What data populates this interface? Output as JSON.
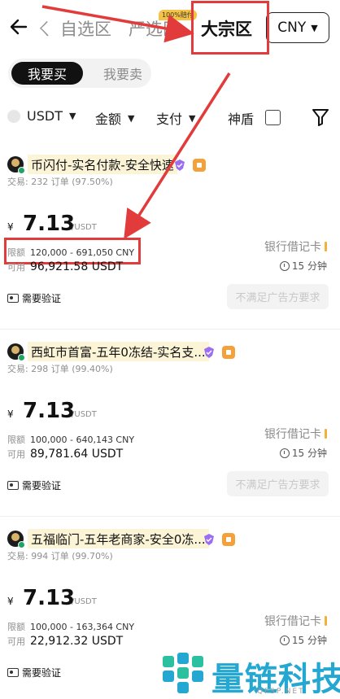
{
  "header": {
    "back_icon": "back-arrow-icon",
    "partial_tab": "ㄑ",
    "tabs": [
      {
        "label": "自选区",
        "active": false
      },
      {
        "label": "严选区",
        "active": false,
        "badge": "100%赔付"
      },
      {
        "label": "大宗区",
        "active": true
      }
    ],
    "currency": "CNY"
  },
  "side_toggle": {
    "buy_label": "我要买",
    "sell_label": "我要卖"
  },
  "filters": {
    "coin": "USDT",
    "amount": "金额",
    "payment": "支付",
    "shield": "神盾",
    "filter_icon": "funnel-icon"
  },
  "ads": [
    {
      "merchant": "币闪付-实名付款-安全快速",
      "stats_label": "交易:",
      "stats": "232 订单 (97.50%)",
      "currency_symbol": "¥",
      "price": "7.13",
      "price_unit": "/USDT",
      "limit_label": "限额",
      "limit": "120,000 - 691,050 CNY",
      "avail_label": "可用",
      "available": "96,921.58 USDT",
      "payment_method": "银行借记卡",
      "pay_time": "15 分钟",
      "verify": "需要验证",
      "action": "不满足广告方要求"
    },
    {
      "merchant": "西虹市首富-五年0冻结-实名支...",
      "stats_label": "交易:",
      "stats": "298 订单 (99.40%)",
      "currency_symbol": "¥",
      "price": "7.13",
      "price_unit": "/USDT",
      "limit_label": "限额",
      "limit": "100,000 - 640,143 CNY",
      "avail_label": "可用",
      "available": "89,781.64 USDT",
      "payment_method": "银行借记卡",
      "pay_time": "15 分钟",
      "verify": "需要验证",
      "action": "不满足广告方要求"
    },
    {
      "merchant": "五福临门-五年老商家-安全0冻...",
      "stats_label": "交易:",
      "stats": "994 订单 (99.70%)",
      "currency_symbol": "¥",
      "price": "7.13",
      "price_unit": "/USDT",
      "limit_label": "限额",
      "limit": "100,000 - 163,364 CNY",
      "avail_label": "可用",
      "available": "22,912.32 USDT",
      "payment_method": "银行借记卡",
      "pay_time": "15 分钟",
      "verify": "需要验证"
    }
  ],
  "watermark": {
    "text": "量链科技",
    "sub": "QFSP.NET"
  },
  "colors": {
    "annotation": "#e23b3b",
    "merchant_highlight": "#fbf4d6",
    "online": "#1fa463",
    "watermark": "#24a7d0"
  }
}
